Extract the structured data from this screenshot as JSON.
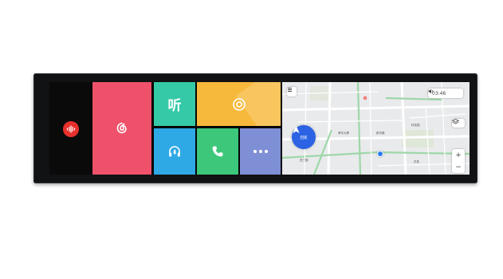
{
  "launcher": {
    "listen_label": "听",
    "more_label": "•••"
  },
  "icons": {
    "voice": "voice-wave-icon",
    "music": "netease-music-icon",
    "radio": "radio-target-icon",
    "bluetooth": "bluetooth-headphones-icon",
    "phone": "phone-icon",
    "menu": "list-menu-icon",
    "volume": "volume-icon",
    "compass": "navigation-arrow-icon",
    "layers": "layers-icon",
    "location": "my-location-icon"
  },
  "map": {
    "status_time": "03:46",
    "nav_badge_label": "回家",
    "zoom_in": "+",
    "zoom_out": "−",
    "place_labels": [
      "荣华大厦",
      "新华路",
      "科技园",
      "西三路",
      "东苑"
    ]
  },
  "colors": {
    "voice_button": "#e8302d",
    "music_tile": "#f0516a",
    "listen_tile": "#36c9a7",
    "radio_tile": "#f7b93c",
    "bluetooth_tile": "#2fa9e6",
    "phone_tile": "#3cc77a",
    "more_tile": "#7f8fd6",
    "nav_badge": "#2b63e4"
  }
}
